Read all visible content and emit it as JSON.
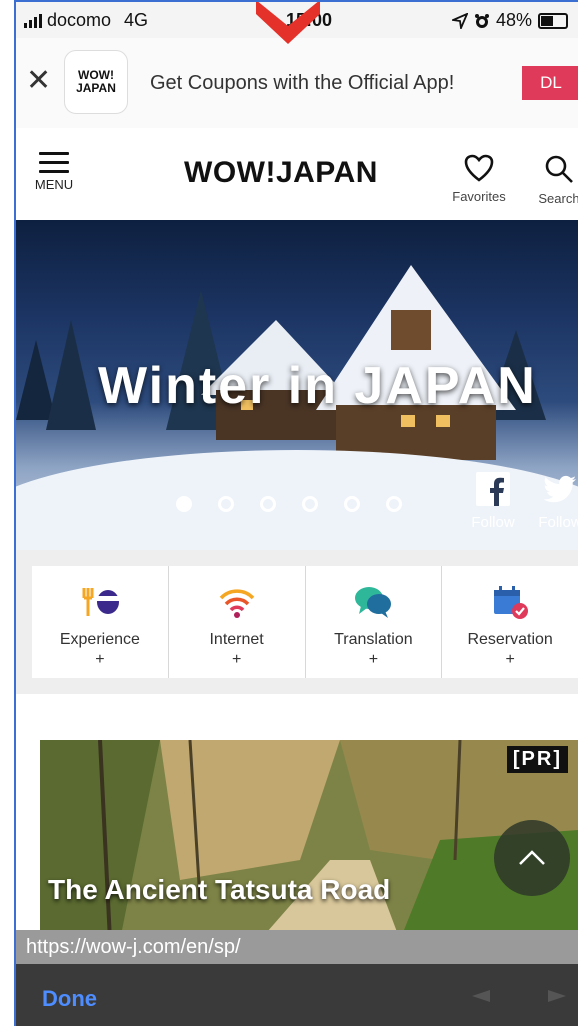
{
  "status_bar": {
    "carrier": "docomo",
    "network": "4G",
    "time": "15:00",
    "battery": "48%",
    "icons": [
      "signal-icon",
      "location-icon",
      "alarm-icon",
      "battery-icon"
    ]
  },
  "app_banner": {
    "icon_text": "WOW!\nJAPAN",
    "message": "Get Coupons with the Official App!",
    "cta": "DL",
    "accent": "#e03a5b"
  },
  "header": {
    "menu_label": "MENU",
    "logo": "WOW!JAPAN",
    "favorites_label": "Favorites",
    "search_label": "Search"
  },
  "hero": {
    "title": "Winter in JAPAN",
    "slides": 6,
    "active_slide": 1,
    "social": [
      {
        "network": "facebook",
        "label": "Follow"
      },
      {
        "network": "twitter",
        "label": "Follow"
      }
    ]
  },
  "categories": [
    {
      "label": "Experience",
      "plus": "+",
      "icon": "dining-icon"
    },
    {
      "label": "Internet",
      "plus": "+",
      "icon": "wifi-icon"
    },
    {
      "label": "Translation",
      "plus": "+",
      "icon": "speech-bubbles-icon"
    },
    {
      "label": "Reservation",
      "plus": "+",
      "icon": "calendar-check-icon"
    }
  ],
  "article": {
    "badge": "[PR]",
    "title": "The Ancient Tatsuta Road"
  },
  "url_bar": {
    "url": "https://wow-j.com/en/sp/"
  },
  "toolbar": {
    "done_label": "Done",
    "link_color": "#4d8dff"
  }
}
